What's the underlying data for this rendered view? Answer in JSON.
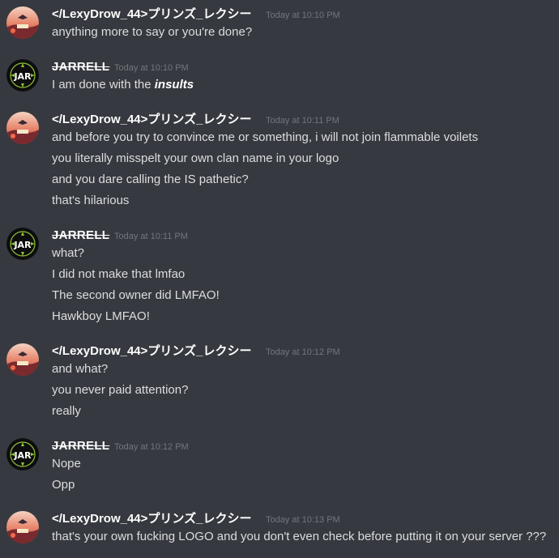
{
  "colors": {
    "background": "#36393f",
    "username": "#ffffff",
    "message_text": "#dcddde",
    "timestamp": "#72767d"
  },
  "users": {
    "lexy": {
      "name": "</LexyDrow_44>プリンズ_レクシー",
      "avatar_icon": "sunset-landscape-avatar"
    },
    "jarrell": {
      "name": "JARRELL",
      "avatar_icon": "jar-logo-avatar"
    }
  },
  "messages": [
    {
      "author": "lexy",
      "timestamp": "Today at 10:10 PM",
      "lines": [
        "anything more to say or you're done?"
      ]
    },
    {
      "author": "jarrell",
      "timestamp": "Today at 10:10 PM",
      "lines_prefix": "I am done with the ",
      "lines_emphasis": "insults"
    },
    {
      "author": "lexy",
      "timestamp": "Today at 10:11 PM",
      "lines": [
        "and before you try to convince me or something, i will not join flammable voilets",
        "you literally misspelt your own clan name in your logo",
        "and you dare calling the IS pathetic?",
        "that's hilarious"
      ]
    },
    {
      "author": "jarrell",
      "timestamp": "Today at 10:11 PM",
      "lines": [
        "what?",
        "I did not make that lmfao",
        "The second owner did LMFAO!",
        "Hawkboy LMFAO!"
      ]
    },
    {
      "author": "lexy",
      "timestamp": "Today at 10:12 PM",
      "lines": [
        "and what?",
        "you never paid attention?",
        "really"
      ]
    },
    {
      "author": "jarrell",
      "timestamp": "Today at 10:12 PM",
      "lines": [
        "Nope",
        "Opp"
      ]
    },
    {
      "author": "lexy",
      "timestamp": "Today at 10:13 PM",
      "lines": [
        "that's your own fucking LOGO and you don't even check before putting it on your server ???"
      ]
    }
  ]
}
